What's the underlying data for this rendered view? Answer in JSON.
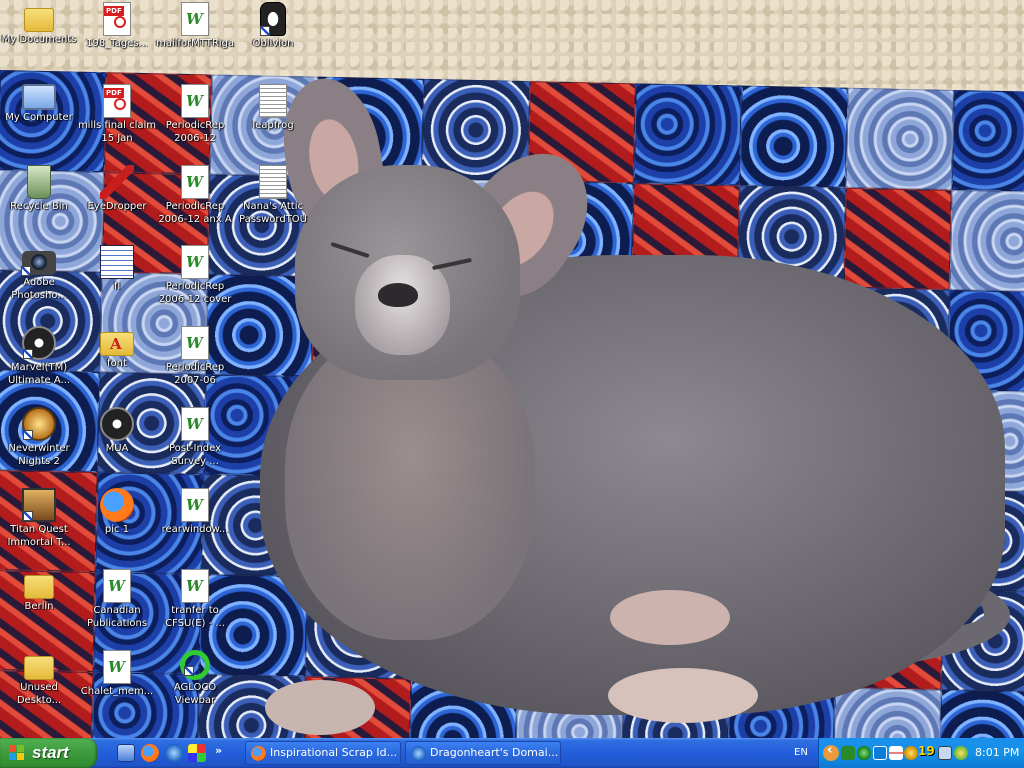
{
  "desktop": {
    "icons": [
      {
        "label": "My Documents"
      },
      {
        "label": "198_Tages..."
      },
      {
        "label": "mailforMTTRiga"
      },
      {
        "label": "Oblivion"
      },
      {
        "label": "My Computer"
      },
      {
        "label": "mills final claim 15 Jan"
      },
      {
        "label": "PeriodicRep 2006-12"
      },
      {
        "label": "leapfrog"
      },
      {
        "label": "Recycle Bin"
      },
      {
        "label": "EyeDropper"
      },
      {
        "label": "PeriodicRep 2006-12 anx A"
      },
      {
        "label": "Nana's Attic PasswordTOU"
      },
      {
        "label": "Adobe Photosho..."
      },
      {
        "label": "fl"
      },
      {
        "label": "PeriodicRep 2006-12 cover"
      },
      {
        "label": "Marvel(TM) Ultimate A..."
      },
      {
        "label": "font"
      },
      {
        "label": "PeriodicRep 2007-06"
      },
      {
        "label": "Neverwinter Nights 2"
      },
      {
        "label": "MUA"
      },
      {
        "label": "Post-Index Survey ..."
      },
      {
        "label": "Titan Quest Immortal T..."
      },
      {
        "label": "pic 1"
      },
      {
        "label": "rearwindow..."
      },
      {
        "label": "Berlin"
      },
      {
        "label": "Canadian Publications"
      },
      {
        "label": "tranfer to CFSU(E) - ..."
      },
      {
        "label": "Unused Deskto..."
      },
      {
        "label": "Chalet_mem..."
      },
      {
        "label": "AGLOCO Viewbar"
      }
    ]
  },
  "taskbar": {
    "start_label": "start",
    "quick_launch_more": "»",
    "tasks": [
      {
        "label": "Inspirational Scrap Id..."
      },
      {
        "label": "Dragonheart's Domai..."
      }
    ],
    "language": "EN",
    "tray_badge": "19",
    "clock": "8:01 PM"
  },
  "colors": {
    "taskbar_blue": "#245edb",
    "start_green": "#3c9a3c",
    "tray_blue": "#1491e8"
  }
}
